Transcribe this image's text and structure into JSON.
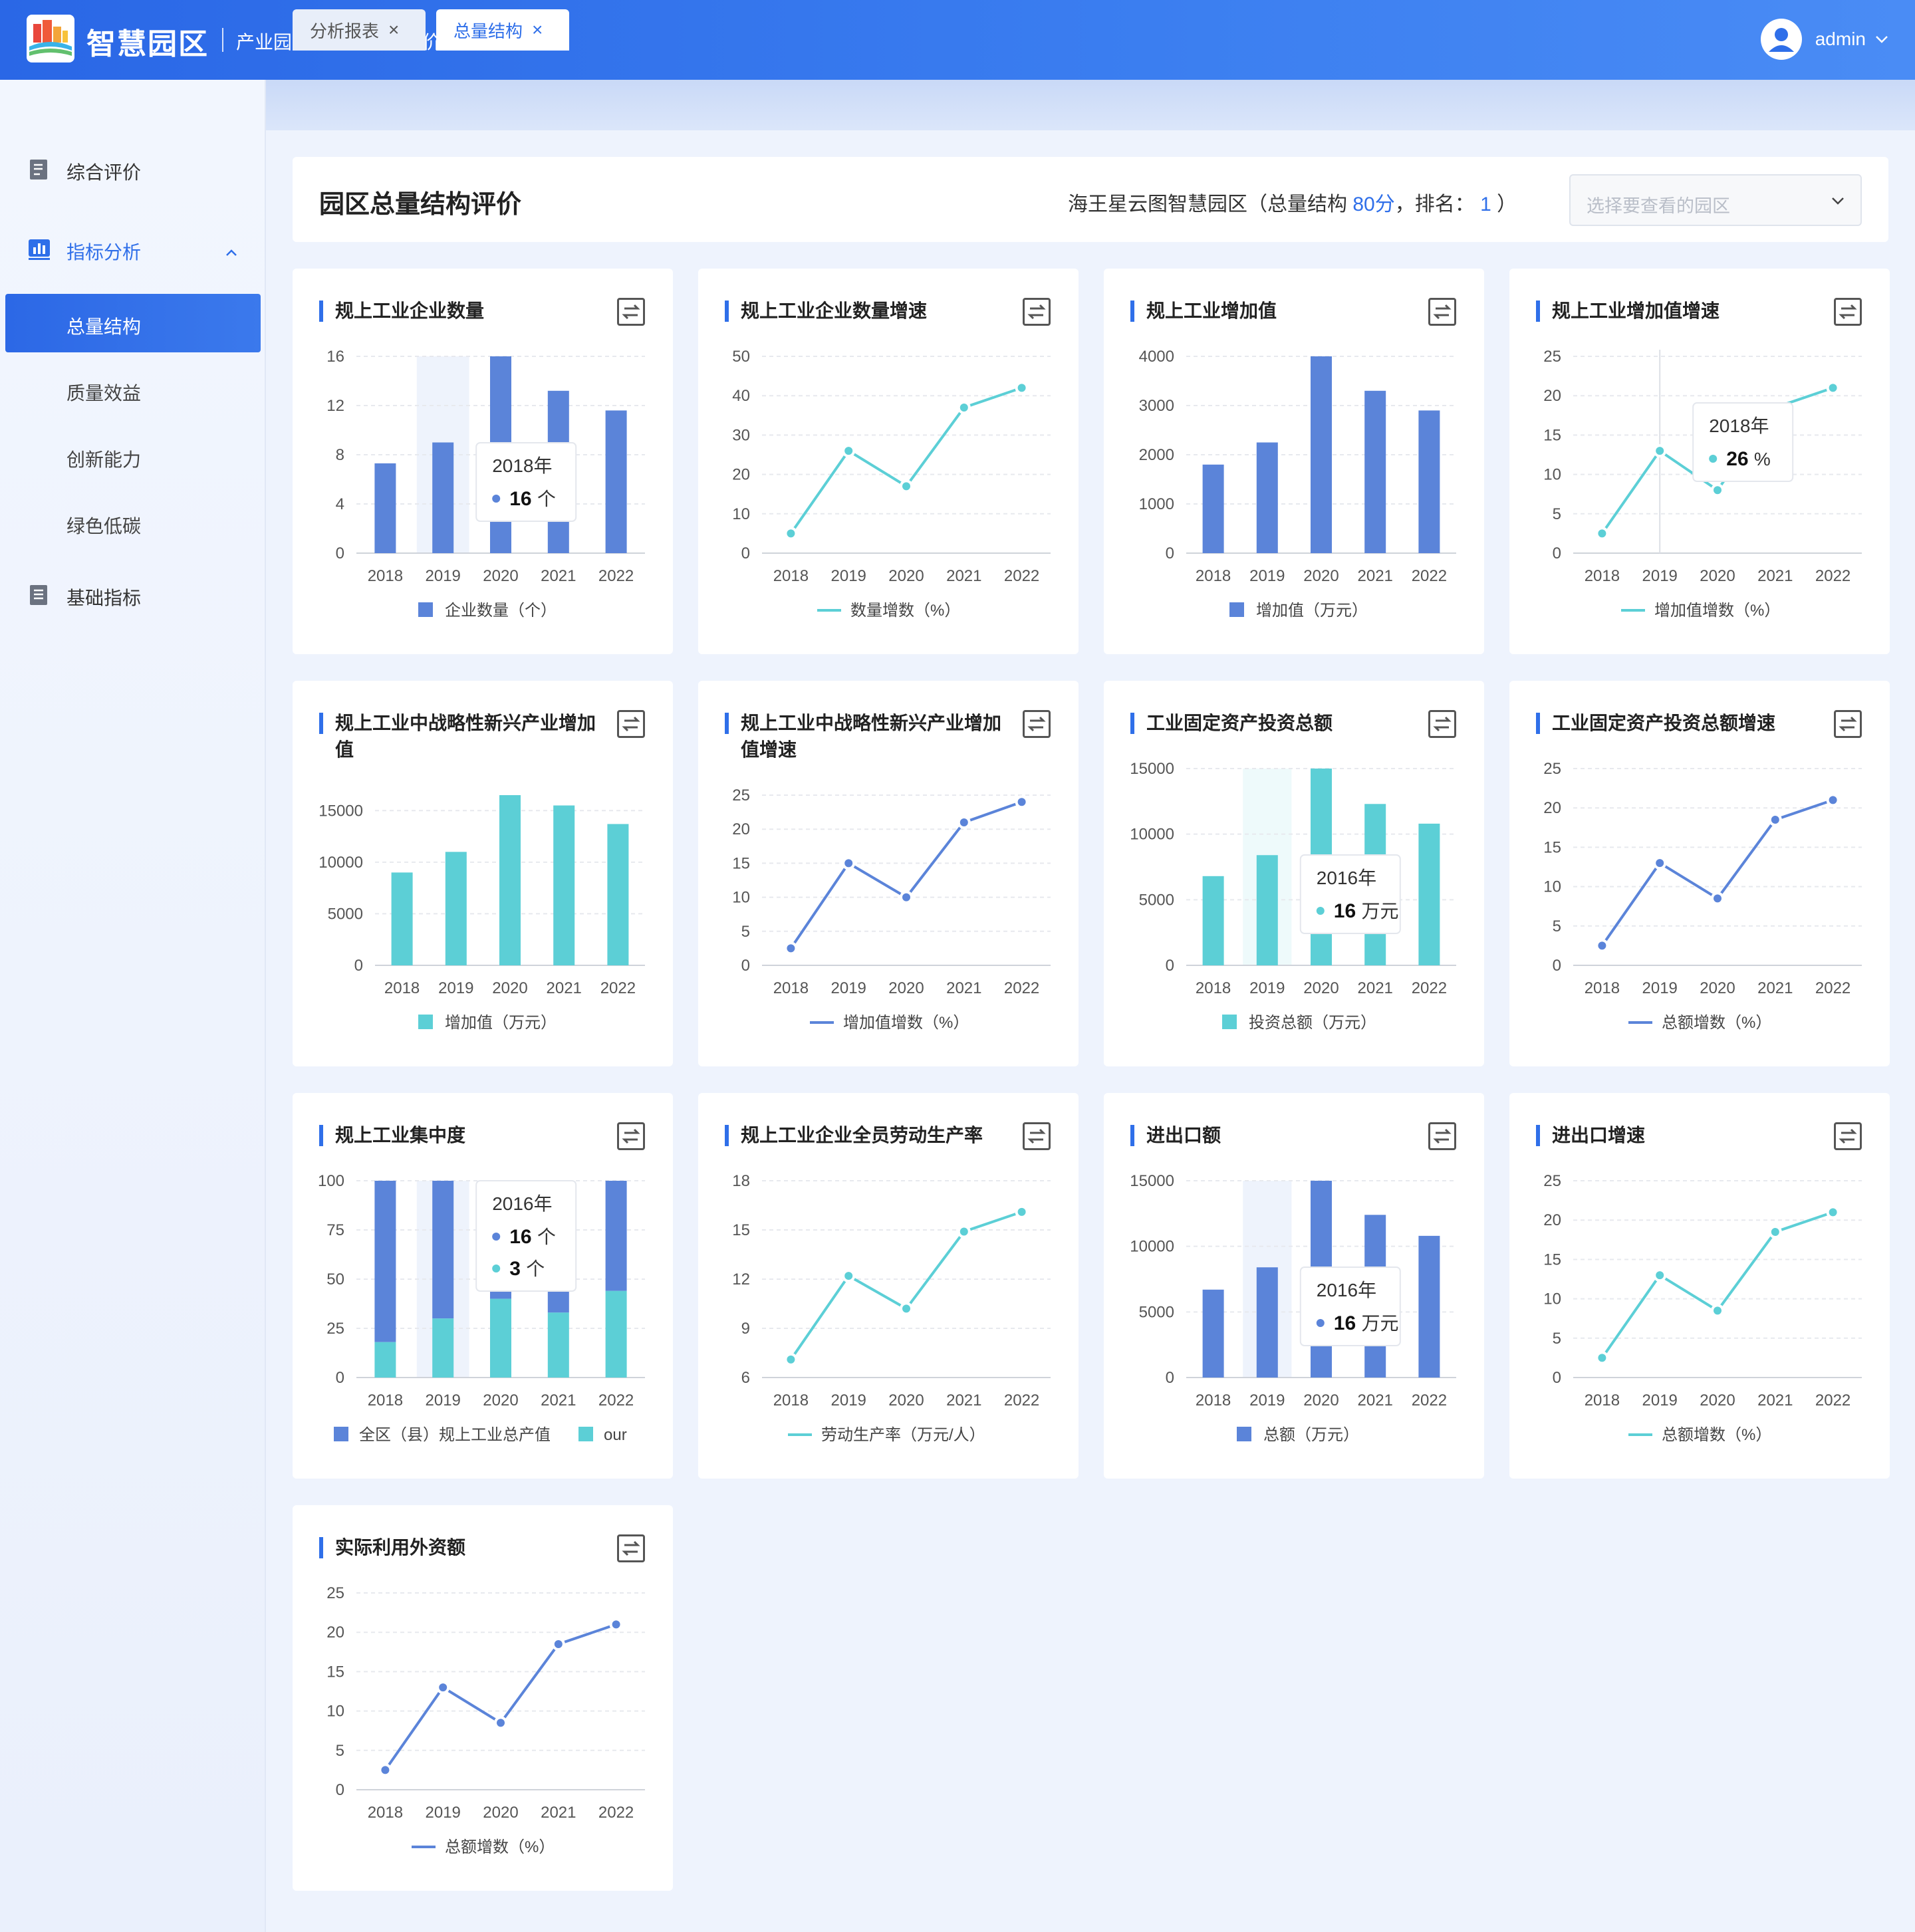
{
  "header": {
    "logo_text": "智慧园区",
    "subtitle": "产业园区高质量发展评价分析平台",
    "user": "admin"
  },
  "sidebar": {
    "items": [
      {
        "label": "综合评价",
        "icon": "document-icon"
      },
      {
        "label": "指标分析",
        "icon": "bar-chart-icon",
        "expanded": true,
        "children": [
          {
            "label": "总量结构",
            "active": true
          },
          {
            "label": "质量效益"
          },
          {
            "label": "创新能力"
          },
          {
            "label": "绿色低碳"
          }
        ]
      },
      {
        "label": "基础指标",
        "icon": "list-icon"
      }
    ]
  },
  "tabs": [
    {
      "label": "分析报表"
    },
    {
      "label": "总量结构",
      "active": true
    }
  ],
  "page": {
    "title": "园区总量结构评价",
    "park_name": "海王星云图智慧园区（总量结构",
    "score": "80分",
    "rank_label": "，排名：",
    "rank": "1",
    "close_paren": "）",
    "select_placeholder": "选择要查看的园区"
  },
  "colors": {
    "blue": "#5b84d9",
    "teal": "#5ccfd6",
    "accent": "#2f6fe9"
  },
  "chart_data": [
    {
      "title": "规上工业企业数量",
      "type": "bar",
      "color": "blue",
      "categories": [
        "2018",
        "2019",
        "2020",
        "2021",
        "2022"
      ],
      "values": [
        7.3,
        9,
        16,
        13.2,
        11.6
      ],
      "ylim": [
        0,
        16
      ],
      "yticks": [
        "0",
        "4",
        "8",
        "12",
        "16"
      ],
      "legend": "企业数量（个）",
      "highlight": 1,
      "tooltip": {
        "title": "2018年",
        "rows": [
          {
            "value": "16",
            "unit": "个",
            "color": "blue"
          }
        ]
      }
    },
    {
      "title": "规上工业企业数量增速",
      "type": "line",
      "color": "teal",
      "categories": [
        "2018",
        "2019",
        "2020",
        "2021",
        "2022"
      ],
      "values": [
        5,
        26,
        17,
        37,
        42
      ],
      "ylim": [
        0,
        50
      ],
      "yticks": [
        "0",
        "10",
        "20",
        "30",
        "40",
        "50"
      ],
      "legend": "数量增数（%）"
    },
    {
      "title": "规上工业增加值",
      "type": "bar",
      "color": "blue",
      "categories": [
        "2018",
        "2019",
        "2020",
        "2021",
        "2022"
      ],
      "values": [
        1800,
        2250,
        4000,
        3300,
        2900
      ],
      "ylim": [
        0,
        4000
      ],
      "yticks": [
        "0",
        "1000",
        "2000",
        "3000",
        "4000"
      ],
      "legend": "增加值（万元）"
    },
    {
      "title": "规上工业增加值增速",
      "type": "line",
      "color": "teal",
      "categories": [
        "2018",
        "2019",
        "2020",
        "2021",
        "2022"
      ],
      "values": [
        2.5,
        13,
        8,
        18.5,
        21
      ],
      "ylim": [
        0,
        25
      ],
      "yticks": [
        "0",
        "5",
        "10",
        "15",
        "20",
        "25"
      ],
      "legend": "增加值增数（%）",
      "crosshair": 1,
      "tooltip": {
        "title": "2018年",
        "rows": [
          {
            "value": "26",
            "unit": "%",
            "color": "teal"
          }
        ]
      }
    },
    {
      "title": "规上工业中战略性新兴产业增加值",
      "type": "bar",
      "color": "teal",
      "categories": [
        "2018",
        "2019",
        "2020",
        "2021",
        "2022"
      ],
      "values": [
        9000,
        11000,
        16500,
        15500,
        13700
      ],
      "ylim": [
        0,
        16500
      ],
      "yticks": [
        "0",
        "5000",
        "10000",
        "15000"
      ],
      "ytick_vals": [
        0,
        5000,
        10000,
        15000
      ],
      "legend": "增加值（万元）"
    },
    {
      "title": "规上工业中战略性新兴产业增加值增速",
      "type": "line",
      "color": "blue",
      "categories": [
        "2018",
        "2019",
        "2020",
        "2021",
        "2022"
      ],
      "values": [
        2.5,
        15,
        10,
        21,
        24
      ],
      "ylim": [
        0,
        25
      ],
      "yticks": [
        "0",
        "5",
        "10",
        "15",
        "20",
        "25"
      ],
      "legend": "增加值增数（%）"
    },
    {
      "title": "工业固定资产投资总额",
      "type": "bar",
      "color": "teal",
      "categories": [
        "2018",
        "2019",
        "2020",
        "2021",
        "2022"
      ],
      "values": [
        6800,
        8400,
        15000,
        12300,
        10800
      ],
      "ylim": [
        0,
        15000
      ],
      "yticks": [
        "0",
        "5000",
        "10000",
        "15000"
      ],
      "legend": "投资总额（万元）",
      "highlight": 1,
      "tooltip": {
        "title": "2016年",
        "rows": [
          {
            "value": "16",
            "unit": "万元",
            "color": "teal"
          }
        ]
      }
    },
    {
      "title": "工业固定资产投资总额增速",
      "type": "line",
      "color": "blue",
      "categories": [
        "2018",
        "2019",
        "2020",
        "2021",
        "2022"
      ],
      "values": [
        2.5,
        13,
        8.5,
        18.5,
        21
      ],
      "ylim": [
        0,
        25
      ],
      "yticks": [
        "0",
        "5",
        "10",
        "15",
        "20",
        "25"
      ],
      "legend": "总额增数（%）"
    },
    {
      "title": "规上工业集中度",
      "type": "stacked",
      "categories": [
        "2018",
        "2019",
        "2020",
        "2021",
        "2022"
      ],
      "series": [
        {
          "name": "全区（县）规上工业总产值",
          "color": "blue",
          "values": [
            100,
            100,
            100,
            100,
            100
          ]
        },
        {
          "name": "our",
          "color": "teal",
          "values": [
            18,
            30,
            40,
            33,
            44
          ]
        }
      ],
      "ylim": [
        0,
        100
      ],
      "yticks": [
        "0",
        "25",
        "50",
        "75",
        "100"
      ],
      "highlight": 1,
      "tooltip": {
        "title": "2016年",
        "rows": [
          {
            "value": "16",
            "unit": "个",
            "color": "blue"
          },
          {
            "value": "3",
            "unit": "个",
            "color": "teal"
          }
        ]
      }
    },
    {
      "title": "规上工业企业全员劳动生产率",
      "type": "line",
      "color": "teal",
      "categories": [
        "2018",
        "2019",
        "2020",
        "2021",
        "2022"
      ],
      "values": [
        7.1,
        12.2,
        10.2,
        14.9,
        16.1
      ],
      "ylim": [
        6,
        18
      ],
      "yticks": [
        "6",
        "9",
        "12",
        "15",
        "18"
      ],
      "ytick_vals": [
        6,
        9,
        12,
        15,
        18
      ],
      "legend": "劳动生产率（万元/人）"
    },
    {
      "title": "进出口额",
      "type": "bar",
      "color": "blue",
      "categories": [
        "2018",
        "2019",
        "2020",
        "2021",
        "2022"
      ],
      "values": [
        6700,
        8400,
        15000,
        12400,
        10800
      ],
      "ylim": [
        0,
        15000
      ],
      "yticks": [
        "0",
        "5000",
        "10000",
        "15000"
      ],
      "legend": "总额（万元）",
      "highlight": 1,
      "tooltip": {
        "title": "2016年",
        "rows": [
          {
            "value": "16",
            "unit": "万元",
            "color": "blue"
          }
        ]
      }
    },
    {
      "title": "进出口增速",
      "type": "line",
      "color": "teal",
      "categories": [
        "2018",
        "2019",
        "2020",
        "2021",
        "2022"
      ],
      "values": [
        2.5,
        13,
        8.5,
        18.5,
        21
      ],
      "ylim": [
        0,
        25
      ],
      "yticks": [
        "0",
        "5",
        "10",
        "15",
        "20",
        "25"
      ],
      "legend": "总额增数（%）"
    },
    {
      "title": "实际利用外资额",
      "type": "line",
      "color": "blue",
      "categories": [
        "2018",
        "2019",
        "2020",
        "2021",
        "2022"
      ],
      "values": [
        2.5,
        13,
        8.5,
        18.5,
        21
      ],
      "ylim": [
        0,
        25
      ],
      "yticks": [
        "0",
        "5",
        "10",
        "15",
        "20",
        "25"
      ],
      "legend": "总额增数（%）"
    }
  ]
}
